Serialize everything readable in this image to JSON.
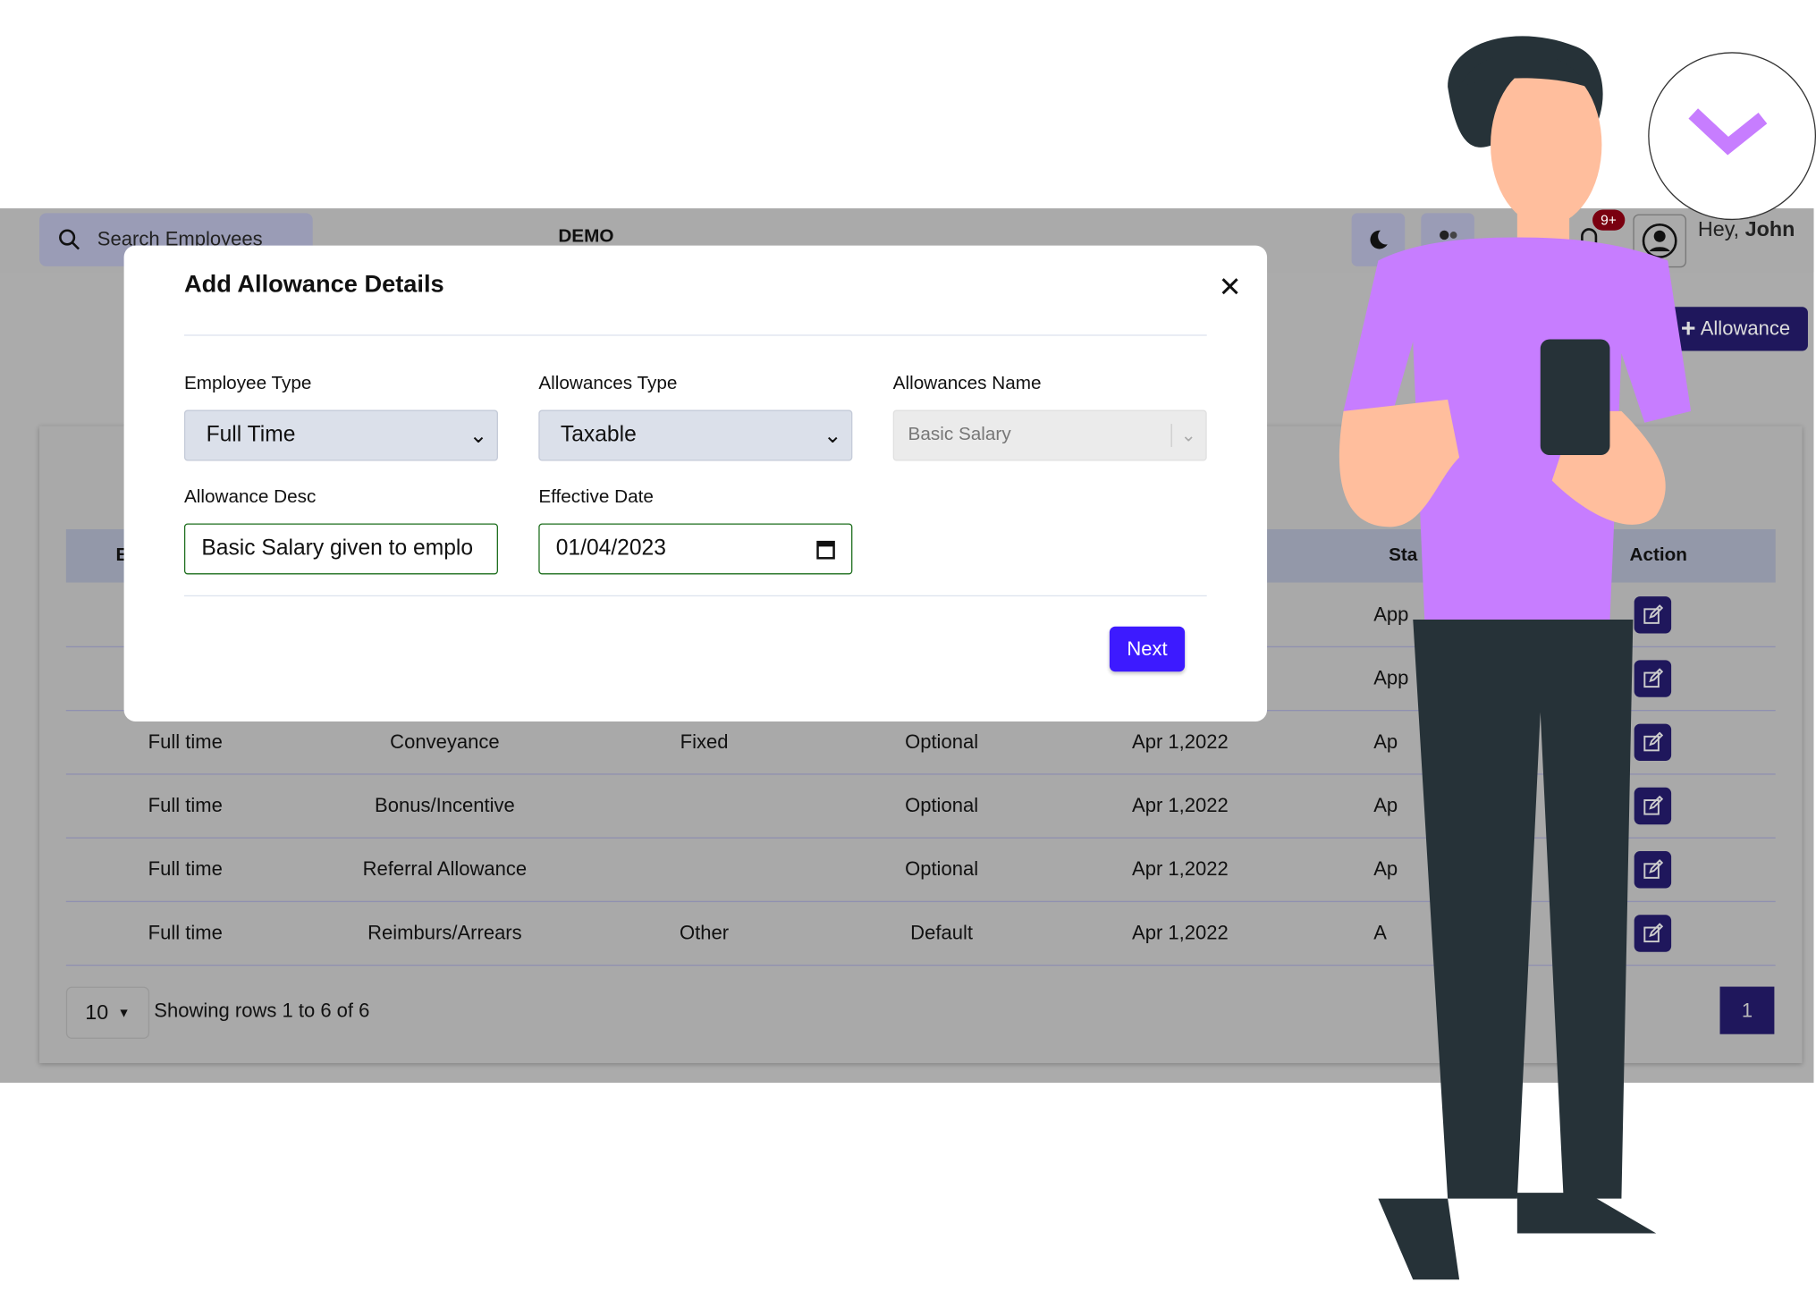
{
  "header": {
    "search_placeholder": "Search Employees",
    "brand": "DEMO",
    "notifications_badge": "9+",
    "greeting": "Hey,",
    "user_name": "John",
    "icons": [
      "search-icon",
      "moon-icon",
      "users-icon",
      "bell-icon",
      "user-circle-icon"
    ]
  },
  "toolbar": {
    "add_allowance_label": "Allowance"
  },
  "table": {
    "headers": [
      "E",
      "Sta",
      "Action"
    ],
    "rows": [
      {
        "employee_type": "",
        "allowance_name": "",
        "type": "",
        "mode": "",
        "effective": "",
        "status": "App"
      },
      {
        "employee_type": "",
        "allowance_name": "",
        "type": "",
        "mode": "",
        "effective": "",
        "status": "App"
      },
      {
        "employee_type": "Full time",
        "allowance_name": "Conveyance",
        "type": "Fixed",
        "mode": "Optional",
        "effective": "Apr 1,2022",
        "status": "Ap"
      },
      {
        "employee_type": "Full time",
        "allowance_name": "Bonus/Incentive",
        "type": "",
        "mode": "Optional",
        "effective": "Apr 1,2022",
        "status": "Ap"
      },
      {
        "employee_type": "Full time",
        "allowance_name": "Referral Allowance",
        "type": "",
        "mode": "Optional",
        "effective": "Apr 1,2022",
        "status": "Ap"
      },
      {
        "employee_type": "Full time",
        "allowance_name": "Reimburs/Arrears",
        "type": "Other",
        "mode": "Default",
        "effective": "Apr 1,2022",
        "status": "A"
      }
    ],
    "page_size": "10",
    "showing": "Showing rows 1 to 6 of 6",
    "current_page": "1"
  },
  "modal": {
    "title": "Add Allowance Details",
    "employee_type_label": "Employee Type",
    "employee_type_value": "Full Time",
    "allowances_type_label": "Allowances Type",
    "allowances_type_value": "Taxable",
    "allowances_name_label": "Allowances Name",
    "allowances_name_value": "Basic Salary",
    "desc_label": "Allowance Desc",
    "desc_value": "Basic Salary given to emplo",
    "date_label": "Effective Date",
    "date_value": "01/04/2023",
    "next_label": "Next"
  },
  "colors": {
    "accent": "#3d1aff",
    "dark_button": "#1f175c",
    "badge": "#7a0010",
    "shirt": "#c77dff"
  }
}
